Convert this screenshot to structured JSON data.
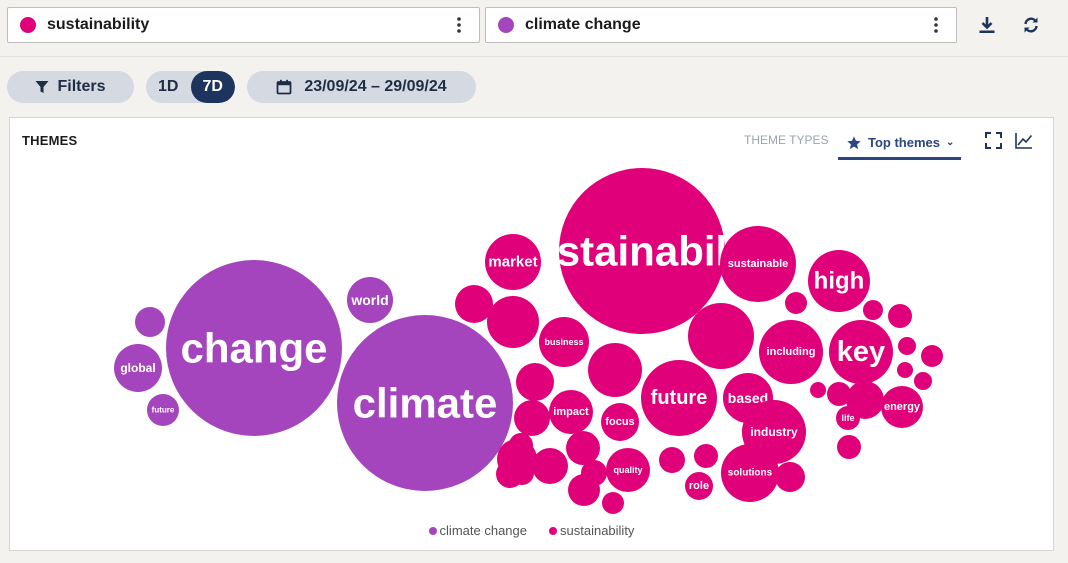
{
  "queries": [
    {
      "label": "sustainability",
      "color": "#e0007a"
    },
    {
      "label": "climate change",
      "color": "#a545bd"
    }
  ],
  "toolbar": {
    "download_icon": "download-icon",
    "refresh_icon": "refresh-icon"
  },
  "filters": {
    "filters_label": "Filters",
    "range_options": [
      "1D",
      "7D"
    ],
    "range_selected": "7D",
    "date_range": "23/09/24 – 29/09/24"
  },
  "panel": {
    "title": "THEMES",
    "theme_types_label": "THEME TYPES",
    "theme_select_label": "Top themes",
    "expand_icon": "expand-icon",
    "chart_icon": "line-chart-icon"
  },
  "colors": {
    "sustainability": "#e0007a",
    "climate_change": "#a545bd"
  },
  "chart_data": {
    "type": "bubble",
    "title": "THEMES",
    "legend_position": "bottom-center",
    "series": [
      {
        "name": "climate change",
        "color": "#a545bd"
      },
      {
        "name": "sustainability",
        "color": "#e0007a"
      }
    ],
    "bubbles": [
      {
        "label": "change",
        "series": "climate change",
        "size": 88
      },
      {
        "label": "climate",
        "series": "climate change",
        "size": 88
      },
      {
        "label": "world",
        "series": "climate change",
        "size": 23
      },
      {
        "label": "global",
        "series": "climate change",
        "size": 24
      },
      {
        "label": "future",
        "series": "climate change",
        "size": 16
      },
      {
        "label": "",
        "series": "climate change",
        "size": 15
      },
      {
        "label": "sustainability",
        "series": "sustainability",
        "size": 83
      },
      {
        "label": "market",
        "series": "sustainability",
        "size": 28
      },
      {
        "label": "sustainable",
        "series": "sustainability",
        "size": 38
      },
      {
        "label": "high",
        "series": "sustainability",
        "size": 31
      },
      {
        "label": "key",
        "series": "sustainability",
        "size": 32
      },
      {
        "label": "including",
        "series": "sustainability",
        "size": 32
      },
      {
        "label": "future",
        "series": "sustainability",
        "size": 38
      },
      {
        "label": "based",
        "series": "sustainability",
        "size": 25
      },
      {
        "label": "industry",
        "series": "sustainability",
        "size": 32
      },
      {
        "label": "business",
        "series": "sustainability",
        "size": 25
      },
      {
        "label": "impact",
        "series": "sustainability",
        "size": 22
      },
      {
        "label": "focus",
        "series": "sustainability",
        "size": 19
      },
      {
        "label": "quality",
        "series": "sustainability",
        "size": 22
      },
      {
        "label": "solutions",
        "series": "sustainability",
        "size": 29
      },
      {
        "label": "energy",
        "series": "sustainability",
        "size": 21
      },
      {
        "label": "life",
        "series": "sustainability",
        "size": 12
      },
      {
        "label": "role",
        "series": "sustainability",
        "size": 14
      },
      {
        "label": "",
        "series": "sustainability",
        "size": 33
      },
      {
        "label": "",
        "series": "sustainability",
        "size": 26
      },
      {
        "label": "",
        "series": "sustainability",
        "size": 27
      },
      {
        "label": "",
        "series": "sustainability",
        "size": 19
      },
      {
        "label": "",
        "series": "sustainability",
        "size": 19
      },
      {
        "label": "",
        "series": "sustainability",
        "size": 18
      },
      {
        "label": "",
        "series": "sustainability",
        "size": 20
      },
      {
        "label": "",
        "series": "sustainability",
        "size": 17
      },
      {
        "label": "",
        "series": "sustainability",
        "size": 13
      },
      {
        "label": "",
        "series": "sustainability",
        "size": 12
      },
      {
        "label": "",
        "series": "sustainability",
        "size": 12
      },
      {
        "label": "",
        "series": "sustainability",
        "size": 11
      },
      {
        "label": "",
        "series": "sustainability",
        "size": 18
      },
      {
        "label": "",
        "series": "sustainability",
        "size": 16
      },
      {
        "label": "",
        "series": "sustainability",
        "size": 13
      },
      {
        "label": "",
        "series": "sustainability",
        "size": 12
      },
      {
        "label": "",
        "series": "sustainability",
        "size": 11
      },
      {
        "label": "",
        "series": "sustainability",
        "size": 10
      },
      {
        "label": "",
        "series": "sustainability",
        "size": 12
      },
      {
        "label": "",
        "series": "sustainability",
        "size": 9
      },
      {
        "label": "",
        "series": "sustainability",
        "size": 11
      },
      {
        "label": "",
        "series": "sustainability",
        "size": 8
      },
      {
        "label": "",
        "series": "sustainability",
        "size": 9
      },
      {
        "label": "",
        "series": "sustainability",
        "size": 8
      },
      {
        "label": "",
        "series": "sustainability",
        "size": 12
      },
      {
        "label": "",
        "series": "sustainability",
        "size": 19
      },
      {
        "label": "",
        "series": "sustainability",
        "size": 12
      },
      {
        "label": "",
        "series": "sustainability",
        "size": 15
      },
      {
        "label": "",
        "series": "sustainability",
        "size": 14
      }
    ]
  }
}
